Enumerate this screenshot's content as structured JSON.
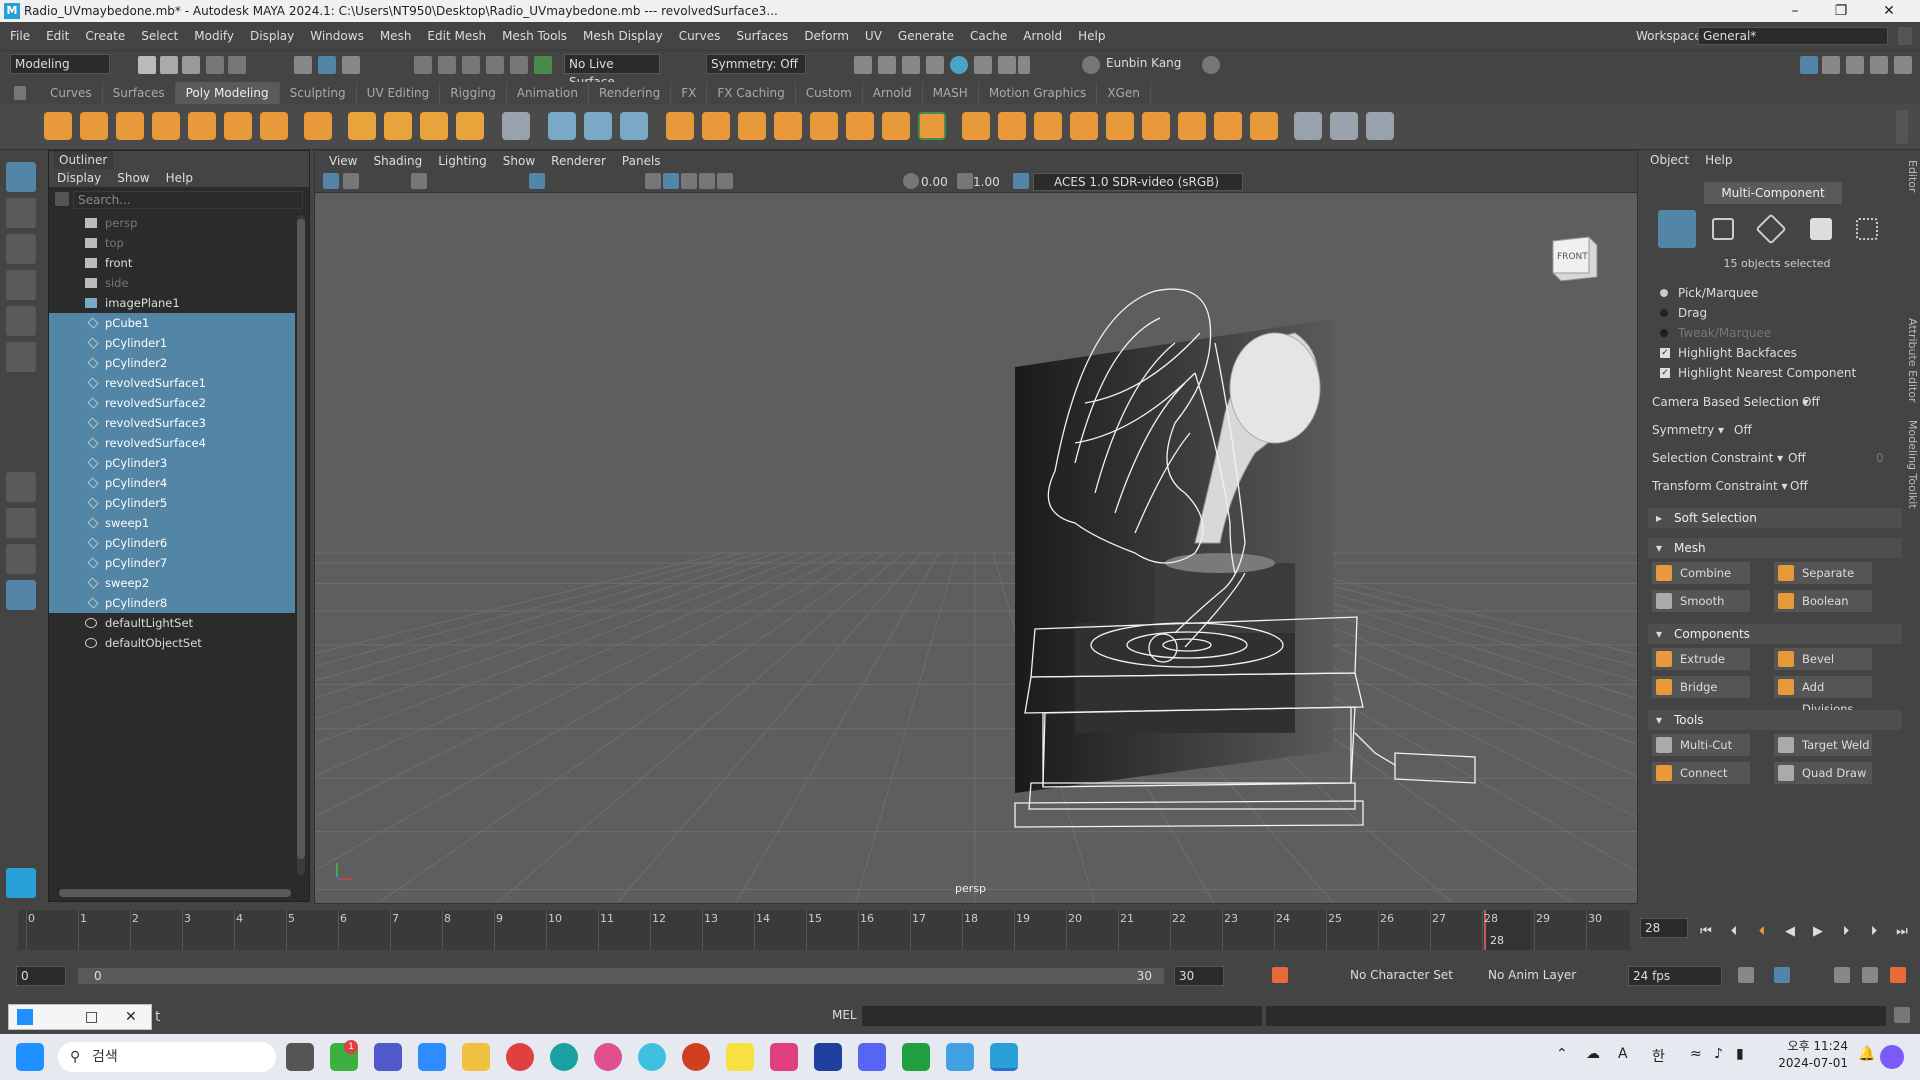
{
  "window": {
    "title": "Radio_UVmaybedone.mb* - Autodesk MAYA 2024.1: C:\\Users\\NT950\\Desktop\\Radio_UVmaybedone.mb   ---   revolvedSurface3...",
    "logo": "M"
  },
  "menubar": {
    "items": [
      "File",
      "Edit",
      "Create",
      "Select",
      "Modify",
      "Display",
      "Windows",
      "Mesh",
      "Edit Mesh",
      "Mesh Tools",
      "Mesh Display",
      "Curves",
      "Surfaces",
      "Deform",
      "UV",
      "Generate",
      "Cache",
      "Arnold",
      "Help"
    ],
    "workspace_label": "Workspace:",
    "workspace_value": "General*"
  },
  "statusline": {
    "mode": "Modeling",
    "live_surface": "No Live Surface",
    "symmetry": "Symmetry: Off",
    "user": "Eunbin Kang"
  },
  "shelf": {
    "tabs": [
      "Curves",
      "Surfaces",
      "Poly Modeling",
      "Sculpting",
      "UV Editing",
      "Rigging",
      "Animation",
      "Rendering",
      "FX",
      "FX Caching",
      "Custom",
      "Arnold",
      "MASH",
      "Motion Graphics",
      "XGen"
    ],
    "active_tab": "Poly Modeling"
  },
  "outliner": {
    "title": "Outliner",
    "menus": [
      "Display",
      "Show",
      "Help"
    ],
    "search_placeholder": "Search...",
    "items": [
      {
        "label": "persp",
        "type": "camera",
        "selected": false,
        "dim": true
      },
      {
        "label": "top",
        "type": "camera",
        "selected": false,
        "dim": true
      },
      {
        "label": "front",
        "type": "camera",
        "selected": false,
        "dim": false
      },
      {
        "label": "side",
        "type": "camera",
        "selected": false,
        "dim": true
      },
      {
        "label": "imagePlane1",
        "type": "image-plane",
        "selected": false,
        "dim": false
      },
      {
        "label": "pCube1",
        "type": "mesh",
        "selected": true,
        "dim": false
      },
      {
        "label": "pCylinder1",
        "type": "mesh",
        "selected": true,
        "dim": false
      },
      {
        "label": "pCylinder2",
        "type": "mesh",
        "selected": true,
        "dim": false
      },
      {
        "label": "revolvedSurface1",
        "type": "mesh",
        "selected": true,
        "dim": false
      },
      {
        "label": "revolvedSurface2",
        "type": "mesh",
        "selected": true,
        "dim": false
      },
      {
        "label": "revolvedSurface3",
        "type": "mesh",
        "selected": true,
        "dim": false
      },
      {
        "label": "revolvedSurface4",
        "type": "mesh",
        "selected": true,
        "dim": false
      },
      {
        "label": "pCylinder3",
        "type": "mesh",
        "selected": true,
        "dim": false
      },
      {
        "label": "pCylinder4",
        "type": "mesh",
        "selected": true,
        "dim": false
      },
      {
        "label": "pCylinder5",
        "type": "mesh",
        "selected": true,
        "dim": false
      },
      {
        "label": "sweep1",
        "type": "mesh",
        "selected": true,
        "dim": false
      },
      {
        "label": "pCylinder6",
        "type": "mesh",
        "selected": true,
        "dim": false
      },
      {
        "label": "pCylinder7",
        "type": "mesh",
        "selected": true,
        "dim": false
      },
      {
        "label": "sweep2",
        "type": "mesh",
        "selected": true,
        "dim": false
      },
      {
        "label": "pCylinder8",
        "type": "mesh",
        "selected": true,
        "dim": false
      },
      {
        "label": "defaultLightSet",
        "type": "set",
        "selected": false,
        "dim": false
      },
      {
        "label": "defaultObjectSet",
        "type": "set",
        "selected": false,
        "dim": false
      }
    ]
  },
  "viewport": {
    "menus": [
      "View",
      "Shading",
      "Lighting",
      "Show",
      "Renderer",
      "Panels"
    ],
    "exposure": "0.00",
    "gamma": "1.00",
    "color_space": "ACES 1.0 SDR-video (sRGB)",
    "camera": "persp",
    "view_cube": "FRONT"
  },
  "modeling_toolkit": {
    "menus": [
      "Object",
      "Help"
    ],
    "mode_button": "Multi-Component",
    "selected_count": "15 objects selected",
    "pick_marquee": "Pick/Marquee",
    "drag": "Drag",
    "tweak_marquee": "Tweak/Marquee",
    "highlight_backfaces": "Highlight Backfaces",
    "highlight_nearest": "Highlight Nearest Component",
    "camera_based_selection": "Camera Based Selection",
    "camera_based_value": "Off",
    "symmetry": "Symmetry",
    "symmetry_value": "Off",
    "selection_constraint": "Selection Constraint",
    "selection_constraint_value": "Off",
    "selection_constraint_num": "0",
    "transform_constraint": "Transform Constraint",
    "transform_constraint_value": "Off",
    "soft_selection": "Soft Selection",
    "mesh_title": "Mesh",
    "combine": "Combine",
    "separate": "Separate",
    "smooth": "Smooth",
    "boolean": "Boolean",
    "components_title": "Components",
    "extrude": "Extrude",
    "bevel": "Bevel",
    "bridge": "Bridge",
    "add_divisions": "Add Divisions",
    "tools_title": "Tools",
    "multi_cut": "Multi-Cut",
    "target_weld": "Target Weld",
    "connect": "Connect",
    "quad_draw": "Quad Draw",
    "side_tabs": [
      "Channel Box / Layer Editor",
      "Attribute Editor",
      "Modeling Toolkit"
    ]
  },
  "timeline": {
    "ticks": [
      "0",
      "1",
      "2",
      "3",
      "4",
      "5",
      "6",
      "7",
      "8",
      "9",
      "10",
      "11",
      "12",
      "13",
      "14",
      "15",
      "16",
      "17",
      "18",
      "19",
      "20",
      "21",
      "22",
      "23",
      "24",
      "25",
      "26",
      "27",
      "28",
      "29",
      "30"
    ],
    "current_frame_label": "28",
    "current_frame_field": "28"
  },
  "range": {
    "start": "0",
    "inner_start": "0",
    "inner_end": "30",
    "end": "30",
    "character_set": "No Character Set",
    "anim_layer": "No Anim Layer",
    "fps": "24 fps"
  },
  "command_line": {
    "lang": "MEL",
    "popup_fragment": "t"
  },
  "taskbar": {
    "search": "검색",
    "badge": "1",
    "ime": "A",
    "lang": "한",
    "time": "오후 11:24",
    "date": "2024-07-01"
  },
  "colors": {
    "selection": "#5285a6",
    "panel": "#444444",
    "viewport_bg": "#5e5e5e",
    "current_frame": "#c85a5a"
  }
}
